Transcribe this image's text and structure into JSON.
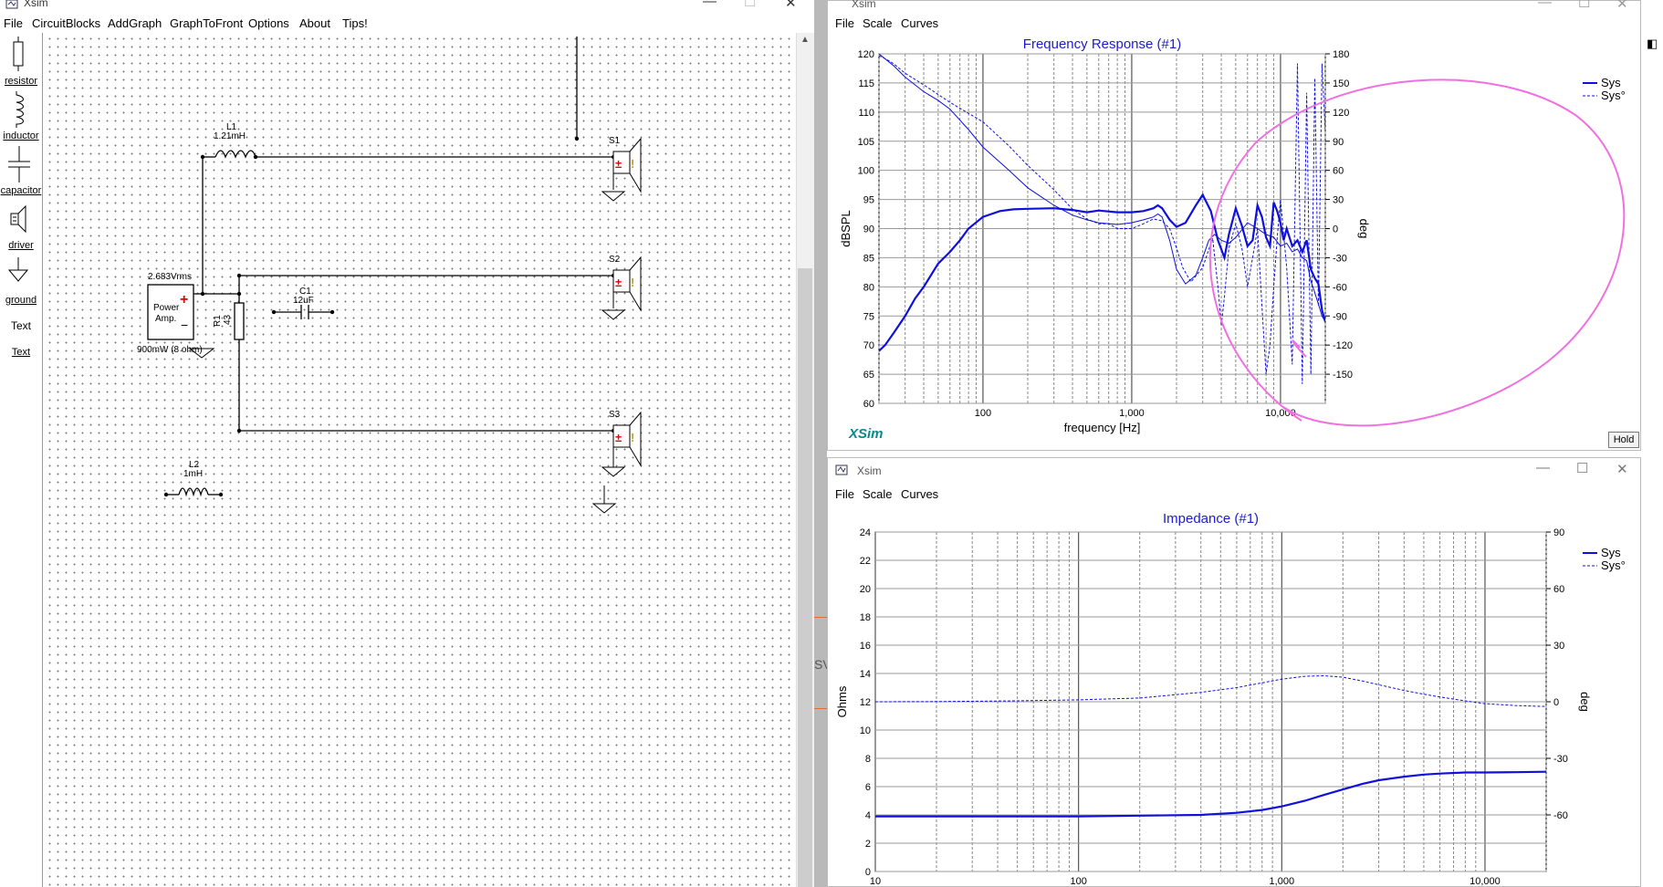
{
  "main_window": {
    "title": "Xsim",
    "menu": [
      "File",
      "CircuitBlocks",
      "AddGraph",
      "GraphToFront",
      "Options",
      "About",
      "Tips!"
    ],
    "palette": [
      {
        "label": "resistor",
        "icon": "resistor-icon"
      },
      {
        "label": "inductor",
        "icon": "inductor-icon"
      },
      {
        "label": "capacitor",
        "icon": "capacitor-icon"
      },
      {
        "label": "driver",
        "icon": "driver-icon"
      },
      {
        "label": "ground",
        "icon": "ground-icon"
      },
      {
        "label": "Text",
        "icon": "text-icon"
      },
      {
        "label": "Text",
        "icon": "text-link"
      }
    ],
    "schematic": {
      "amp_voltage": "2.683Vrms",
      "amp_label_1": "Power",
      "amp_label_2": "Amp.",
      "amp_power": "900mW (8 ohm)",
      "l1_name": "L1",
      "l1_value": "1.21mH",
      "l2_name": "L2",
      "l2_value": "1mH",
      "c1_name": "C1",
      "c1_value": "12uF",
      "r1_name": "R1",
      "r1_value": "43",
      "s1": "S1",
      "s2": "S2",
      "s3": "S3"
    }
  },
  "side_text": "SV",
  "freq_window": {
    "title": "Xsim",
    "menu": [
      "File",
      "Scale",
      "Curves"
    ],
    "hold_label": "Hold",
    "brand": "XSim"
  },
  "imp_window": {
    "title": "Xsim",
    "menu": [
      "File",
      "Scale",
      "Curves"
    ]
  },
  "chart_data": [
    {
      "type": "line",
      "title": "Frequency Response (#1)",
      "xlabel": "frequency [Hz]",
      "ylabel": "dBSPL",
      "y2label": "deg",
      "xscale": "log",
      "xlim": [
        20,
        20000
      ],
      "ylim": [
        60,
        120
      ],
      "y2lim": [
        -180,
        180
      ],
      "x_ticks": [
        "100",
        "1,000",
        "10,000"
      ],
      "y_ticks": [
        "60",
        "65",
        "70",
        "75",
        "80",
        "85",
        "90",
        "95",
        "100",
        "105",
        "110",
        "115",
        "120"
      ],
      "y2_ticks": [
        "-150",
        "-120",
        "-90",
        "-60",
        "-30",
        "0",
        "30",
        "60",
        "90",
        "120",
        "150",
        "180"
      ],
      "grid": true,
      "legend_position": "top-right",
      "annotation": "pink freehand ellipse circling the response above ~1.5 kHz",
      "series": [
        {
          "name": "Sys",
          "style": "solid",
          "axis": "left",
          "x": [
            20,
            22,
            25,
            30,
            35,
            40,
            50,
            60,
            70,
            80,
            100,
            130,
            160,
            200,
            300,
            400,
            500,
            600,
            800,
            1000,
            1200,
            1400,
            1500,
            1600,
            1800,
            2000,
            2300,
            2700,
            3000,
            3400,
            3800,
            4200,
            4500,
            5000,
            5500,
            6000,
            6500,
            7000,
            7500,
            8000,
            8500,
            9000,
            9500,
            10000,
            10500,
            11000,
            12000,
            13000,
            14000,
            15000,
            16000,
            17000,
            18000,
            19000,
            20000
          ],
          "y": [
            69,
            70,
            72,
            75,
            78,
            80,
            84,
            86,
            88,
            90,
            92,
            93,
            93.3,
            93.4,
            93.5,
            93.2,
            92.8,
            93.1,
            92.8,
            92.8,
            93,
            93.5,
            94,
            93.5,
            91.5,
            90.3,
            91,
            94,
            95.8,
            93,
            88,
            85,
            89,
            93.5,
            90.5,
            87,
            88,
            94,
            92,
            88.5,
            87,
            94.5,
            93,
            91,
            88,
            90,
            87,
            88,
            86,
            88,
            83,
            81.5,
            80.5,
            76,
            74
          ]
        },
        {
          "name": "Sys°",
          "style": "dashed",
          "axis": "right",
          "x": [
            20,
            22,
            25,
            30,
            40,
            60,
            100,
            150,
            200,
            300,
            400,
            500,
            600,
            700,
            800,
            1000,
            1200,
            1400,
            1600,
            1800,
            2000,
            2200,
            2500,
            3000,
            3500,
            3800,
            4000,
            4200,
            4500,
            5000,
            5500,
            6000,
            6500,
            7000,
            7500,
            8000,
            8500,
            9000,
            9500,
            10000,
            11000,
            12000,
            13000,
            14000,
            15000,
            16000,
            17000,
            18000,
            19000,
            20000
          ],
          "y": [
            178,
            175,
            170,
            160,
            148,
            130,
            110,
            85,
            65,
            40,
            20,
            10,
            5,
            5,
            0,
            0,
            5,
            10,
            8,
            0,
            -20,
            -40,
            -55,
            -40,
            -10,
            -60,
            -100,
            -70,
            -20,
            5,
            -20,
            -60,
            -30,
            0,
            -80,
            -150,
            -120,
            -60,
            -10,
            30,
            -40,
            -140,
            170,
            -160,
            140,
            -150,
            155,
            -80,
            170,
            100
          ]
        },
        {
          "name": "",
          "style": "solid-thin",
          "axis": "left",
          "x": [
            20,
            25,
            30,
            40,
            50,
            60,
            80,
            100,
            150,
            200,
            300,
            400,
            500,
            600,
            800,
            1000,
            1200,
            1400,
            1500,
            1600,
            1800,
            2000,
            2300,
            2700,
            3000,
            3300,
            3600,
            4000,
            4500,
            5000,
            6000,
            7000,
            8000,
            9000,
            10000,
            11000,
            12000,
            13000,
            14000,
            15000,
            16000,
            17000,
            18000,
            19000,
            20000
          ],
          "y": [
            120,
            118,
            116,
            113.5,
            112,
            110.5,
            107,
            104,
            100,
            97,
            94,
            92.3,
            91.5,
            91,
            90.7,
            91,
            91.5,
            92,
            92.5,
            92,
            88,
            83,
            80.5,
            82,
            85,
            88,
            89,
            88,
            87.5,
            88.5,
            91,
            90,
            89,
            88.5,
            87,
            87.5,
            86,
            86.5,
            85,
            84.5,
            81,
            79,
            77,
            75,
            74
          ]
        }
      ]
    },
    {
      "type": "line",
      "title": "Impedance (#1)",
      "xlabel": "",
      "ylabel": "Ohms",
      "y2label": "deg",
      "xscale": "log",
      "xlim": [
        10,
        20000
      ],
      "ylim": [
        0,
        24
      ],
      "y2lim": [
        -90,
        90
      ],
      "x_ticks": [
        "10",
        "100",
        "1,000",
        "10,000"
      ],
      "y_ticks": [
        "0",
        "2",
        "4",
        "6",
        "8",
        "10",
        "12",
        "14",
        "16",
        "18",
        "20",
        "22",
        "24"
      ],
      "y2_ticks": [
        "-60",
        "-30",
        "0",
        "30",
        "60",
        "90"
      ],
      "grid": true,
      "legend_position": "top-right",
      "series": [
        {
          "name": "Sys",
          "style": "solid",
          "axis": "left",
          "x": [
            10,
            20,
            50,
            100,
            200,
            400,
            600,
            800,
            1000,
            1300,
            1600,
            2000,
            2500,
            3000,
            4000,
            5000,
            6000,
            8000,
            10000,
            14000,
            20000
          ],
          "y": [
            3.9,
            3.9,
            3.9,
            3.9,
            3.95,
            4.0,
            4.15,
            4.35,
            4.6,
            5.0,
            5.4,
            5.8,
            6.2,
            6.45,
            6.7,
            6.85,
            6.92,
            7.0,
            7.0,
            7.02,
            7.05
          ]
        },
        {
          "name": "Sys°",
          "style": "dashed",
          "axis": "right",
          "x": [
            10,
            20,
            50,
            100,
            200,
            400,
            600,
            800,
            1000,
            1300,
            1600,
            2000,
            2500,
            3000,
            4000,
            5000,
            6000,
            8000,
            10000,
            14000,
            20000
          ],
          "y": [
            0,
            0.1,
            0.5,
            1,
            2,
            5,
            7.5,
            10,
            12,
            13.5,
            13.8,
            13,
            11,
            9,
            6,
            4,
            2.5,
            0.5,
            -1,
            -2,
            -2.5
          ]
        }
      ]
    }
  ]
}
